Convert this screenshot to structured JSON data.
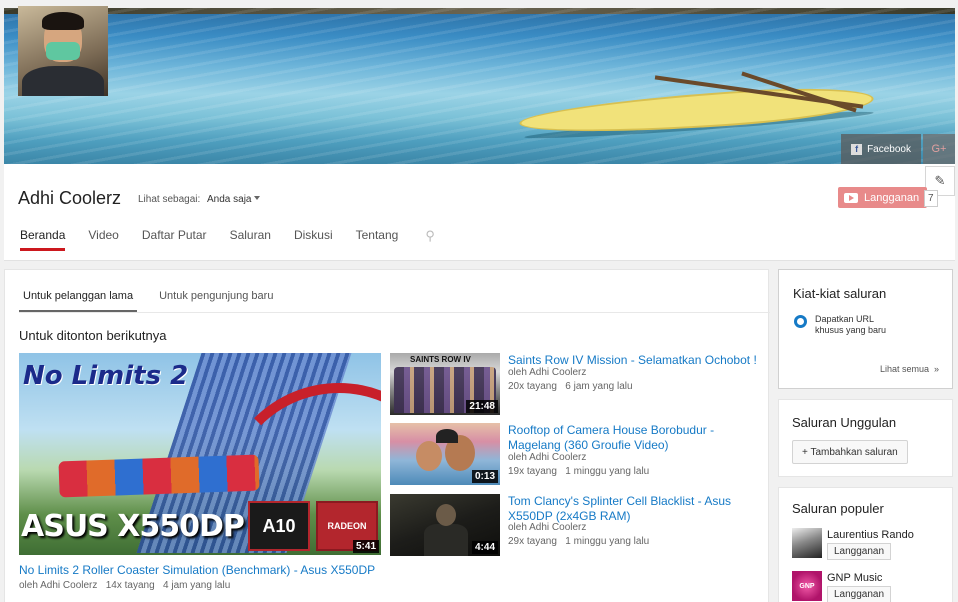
{
  "channel": {
    "name": "Adhi Coolerz",
    "view_as_label": "Lihat sebagai:",
    "view_as_value": "Anda saja",
    "subscribe_label": "Langganan",
    "subscriber_count": "7",
    "social": {
      "facebook": "Facebook",
      "google_plus": "G+"
    }
  },
  "tabs": [
    "Beranda",
    "Video",
    "Daftar Putar",
    "Saluran",
    "Diskusi",
    "Tentang"
  ],
  "subtabs": [
    "Untuk pelanggan lama",
    "Untuk pengunjung baru"
  ],
  "section_title": "Untuk ditonton berikutnya",
  "featured_video": {
    "title": "No Limits 2 Roller Coaster Simulation (Benchmark) - Asus X550DP",
    "by": "oleh Adhi Coolerz",
    "views": "14x tayang",
    "age": "4 jam yang lalu",
    "duration": "5:41",
    "thumb_text_top": "No Limits 2",
    "thumb_text_bottom": "ASUS X550DP",
    "thumb_badge_a10": "A10",
    "thumb_badge_radeon": "RADEON"
  },
  "videos": [
    {
      "title": "Saints Row IV Mission - Selamatkan Ochobot !",
      "by": "oleh Adhi Coolerz",
      "views": "20x tayang",
      "age": "6 jam yang lalu",
      "duration": "21:48",
      "thumb_text": "SAINTS ROW IV"
    },
    {
      "title": "Rooftop of Camera House Borobudur - Magelang (360 Groufie Video)",
      "by": "oleh Adhi Coolerz",
      "views": "19x tayang",
      "age": "1 minggu yang lalu",
      "duration": "0:13"
    },
    {
      "title": "Tom Clancy's Splinter Cell Blacklist - Asus X550DP (2x4GB RAM)",
      "by": "oleh Adhi Coolerz",
      "views": "29x tayang",
      "age": "1 minggu yang lalu",
      "duration": "4:44"
    }
  ],
  "sidebar": {
    "tips_title": "Kiat-kiat saluran",
    "tips_item": "Dapatkan URL khusus yang baru",
    "see_all": "Lihat semua",
    "featured_title": "Saluran Unggulan",
    "add_channel": "+ Tambahkan saluran",
    "popular_title": "Saluran populer",
    "popular": [
      {
        "name": "Laurentius Rando",
        "subscribe": "Langganan"
      },
      {
        "name": "GNP Music",
        "subscribe": "Langganan",
        "avatar_text": "GNP"
      }
    ]
  },
  "colors": {
    "accent_red": "#cc181e",
    "link_blue": "#167ac6",
    "subscribe_bg": "#e88a8a"
  }
}
